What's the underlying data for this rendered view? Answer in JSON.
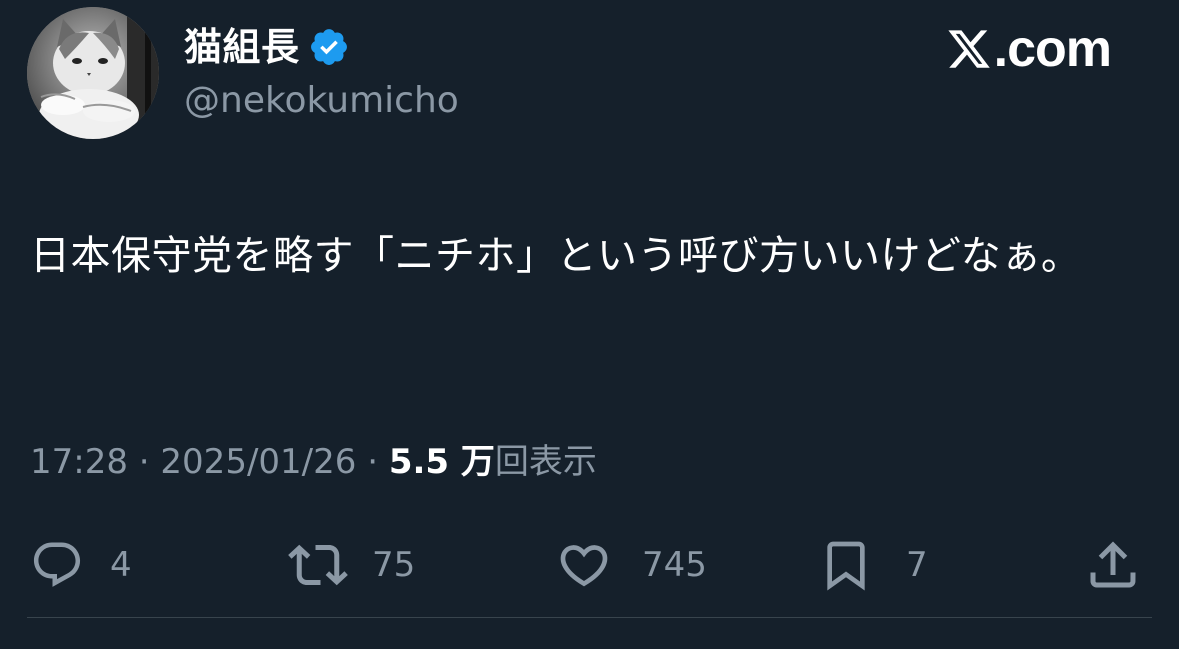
{
  "brand": {
    "label": ".com",
    "icon": "x-logo-icon"
  },
  "user": {
    "display_name": "猫組長",
    "handle": "@nekokumicho",
    "verified_icon": "verified-badge-icon",
    "avatar": "cat-avatar"
  },
  "tweet": {
    "text": "日本保守党を略す「ニチホ」という呼び方いいけどなぁ。"
  },
  "meta": {
    "time": "17:28",
    "separator": " · ",
    "date": "2025/01/26",
    "views_count": "5.5 万",
    "views_label": "回表示"
  },
  "actions": {
    "reply": {
      "count": "4",
      "icon": "reply-icon"
    },
    "retweet": {
      "count": "75",
      "icon": "retweet-icon"
    },
    "like": {
      "count": "745",
      "icon": "heart-icon"
    },
    "bookmark": {
      "count": "7",
      "icon": "bookmark-icon"
    },
    "share": {
      "icon": "share-icon"
    }
  },
  "colors": {
    "background": "#15202b",
    "secondary_text": "#8b98a5",
    "verified_blue": "#1d9bf0",
    "divider": "#38444d"
  }
}
